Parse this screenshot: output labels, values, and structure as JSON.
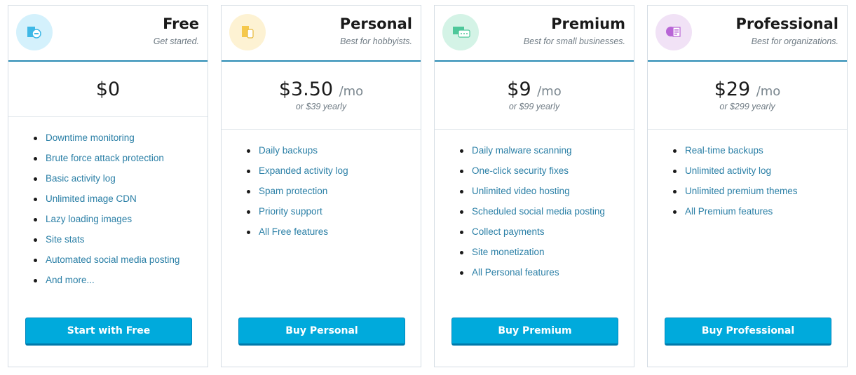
{
  "plans": [
    {
      "name": "Free",
      "tagline": "Get started.",
      "price": "$0",
      "per": "",
      "yearly": "",
      "icon": "free-plan-icon",
      "icon_bg": "#d4f1fc",
      "features": [
        "Downtime monitoring",
        "Brute force attack protection",
        "Basic activity log",
        "Unlimited image CDN",
        "Lazy loading images",
        "Site stats",
        "Automated social media posting",
        "And more..."
      ],
      "button": "Start with Free"
    },
    {
      "name": "Personal",
      "tagline": "Best for hobbyists.",
      "price": "$3.50",
      "per": "/mo",
      "yearly": "or $39 yearly",
      "icon": "personal-plan-icon",
      "icon_bg": "#fdf2d3",
      "features": [
        "Daily backups",
        "Expanded activity log",
        "Spam protection",
        "Priority support",
        "All Free features"
      ],
      "button": "Buy Personal"
    },
    {
      "name": "Premium",
      "tagline": "Best for small businesses.",
      "price": "$9",
      "per": "/mo",
      "yearly": "or $99 yearly",
      "icon": "premium-plan-icon",
      "icon_bg": "#d4f3e6",
      "features": [
        "Daily malware scanning",
        "One-click security fixes",
        "Unlimited video hosting",
        "Scheduled social media posting",
        "Collect payments",
        "Site monetization",
        "All Personal features"
      ],
      "button": "Buy Premium"
    },
    {
      "name": "Professional",
      "tagline": "Best for organizations.",
      "price": "$29",
      "per": "/mo",
      "yearly": "or $299 yearly",
      "icon": "professional-plan-icon",
      "icon_bg": "#f1e2f6",
      "features": [
        "Real-time backups",
        "Unlimited activity log",
        "Unlimited premium themes",
        "All Premium features"
      ],
      "button": "Buy Professional"
    }
  ],
  "colors": {
    "accent": "#00aadc",
    "link": "#2a7fa6",
    "divider": "#2a8bb4"
  }
}
